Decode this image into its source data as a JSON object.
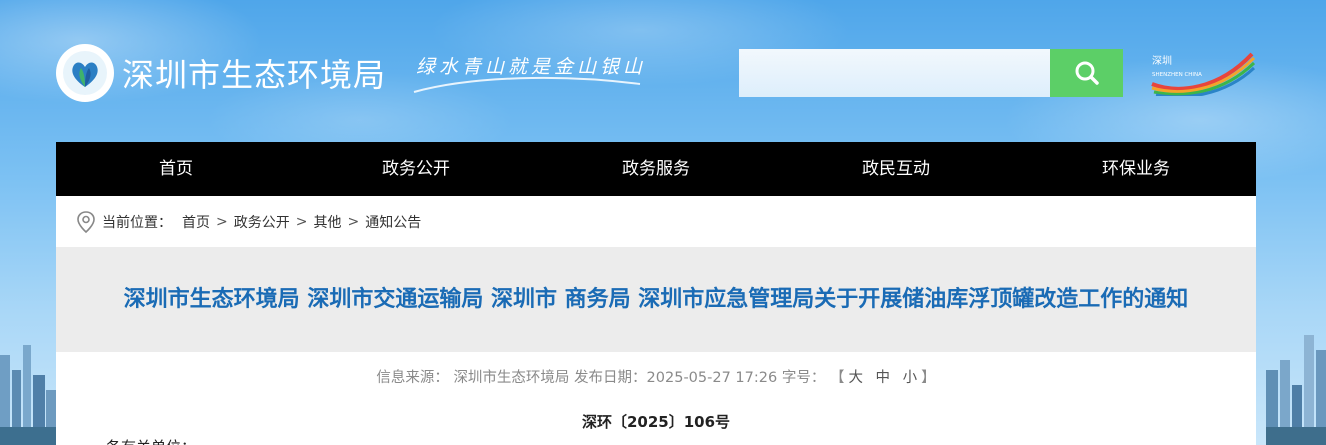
{
  "header": {
    "site_name": "深圳市生态环境局",
    "slogan": "绿水青山就是金山银山",
    "sz_logo_text": "深圳 SHENZHEN CHINA"
  },
  "search": {
    "placeholder": "",
    "button_icon": "search-icon"
  },
  "nav": {
    "items": [
      {
        "label": "首页"
      },
      {
        "label": "政务公开"
      },
      {
        "label": "政务服务"
      },
      {
        "label": "政民互动"
      },
      {
        "label": "环保业务"
      }
    ]
  },
  "breadcrumb": {
    "icon": "location-pin-icon",
    "label": "当前位置：",
    "items": [
      "首页",
      "政务公开",
      "其他",
      "通知公告"
    ],
    "separator": ">"
  },
  "article": {
    "title": "深圳市生态环境局 深圳市交通运输局 深圳市 商务局 深圳市应急管理局关于开展储油库浮顶罐改造工作的通知",
    "source_label": "信息来源：",
    "source": "深圳市生态环境局",
    "date_label": "发布日期：",
    "date": "2025-05-27 17:26",
    "fontsize_label": "字号：",
    "fontsize_open": "【",
    "fontsize_large": "大",
    "fontsize_medium": "中",
    "fontsize_small": "小",
    "fontsize_close": "】",
    "doc_number": "深环〔2025〕106号",
    "addressee": "各有关单位："
  },
  "colors": {
    "nav_bg": "#000000",
    "title_color": "#1a6bb5",
    "search_button": "#5ccf67",
    "title_band": "#ececec"
  }
}
